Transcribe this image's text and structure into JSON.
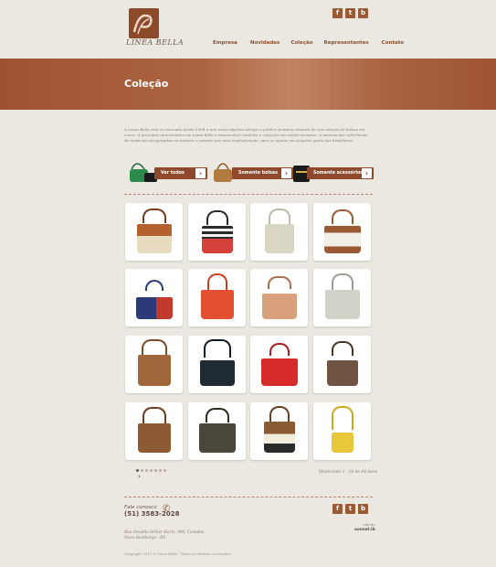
{
  "brand": {
    "logo_text": "LINEA BELLA"
  },
  "social": [
    "f",
    "t",
    "b"
  ],
  "nav": [
    {
      "label": "Empresa"
    },
    {
      "label": "Novidades"
    },
    {
      "label": "Coleção"
    },
    {
      "label": "Representantes"
    },
    {
      "label": "Contato"
    }
  ],
  "banner": {
    "title": "Coleção"
  },
  "intro": "A Linea Bella está no mercado desde 1994 e tem como objetivo atingir o público feminino através de sua coleção de bolsas em couro. A principal característica da Linea Bella é desenvolver modelos e coleções em estilos variados. A maioria das referências de moda são pesquisadas no exterior e passam por uma tropicalização, para se ajustar ao exigente gosto das brasileiras.",
  "filters": [
    {
      "label": "Ver todos"
    },
    {
      "label": "Somente bolsas"
    },
    {
      "label": "Somente acessórios"
    }
  ],
  "products": [
    {
      "colors": [
        "#e8dcc0",
        "#b5612f"
      ]
    },
    {
      "colors": [
        "#d6403a",
        "#2a2a2a"
      ]
    },
    {
      "colors": [
        "#d9d6c3",
        "#bdb9a5"
      ]
    },
    {
      "colors": [
        "#f1efe6",
        "#9a5a34"
      ]
    },
    {
      "colors": [
        "#2c3a7a",
        "#c33a2c"
      ]
    },
    {
      "colors": [
        "#e2502f",
        "#c7401f"
      ]
    },
    {
      "colors": [
        "#d9a07c",
        "#c58a66"
      ]
    },
    {
      "colors": [
        "#cfd2c6",
        "#b7bbb0"
      ]
    },
    {
      "colors": [
        "#a0683a",
        "#8a5530"
      ]
    },
    {
      "colors": [
        "#1f2a33",
        "#111a20"
      ]
    },
    {
      "colors": [
        "#d62d2a",
        "#b52320"
      ]
    },
    {
      "colors": [
        "#6f5444",
        "#5a4234"
      ]
    },
    {
      "colors": [
        "#8e5a33",
        "#7a4a28"
      ]
    },
    {
      "colors": [
        "#4a463a",
        "#2d2a22"
      ]
    },
    {
      "colors": [
        "#f2ecdc",
        "#2a2a2a"
      ]
    },
    {
      "colors": [
        "#e8c83a",
        "#d6b424"
      ]
    }
  ],
  "pager": {
    "dots": 7,
    "active": 0,
    "count_text": "Mostrando 1 - 16 de 84 itens"
  },
  "footer": {
    "phone_label": "Fale conosco",
    "phone": "(51) 3583-2028",
    "address_1": "Rua Osvaldo Arthur Hartz, 980, Canudos",
    "address_2": "Novo Hamburgo - RS",
    "copyright": "Copyright 2013 © Linea Bella - Todos os direitos reservados.",
    "credit_1": "site by",
    "credit_2": "oonnet.lb"
  }
}
